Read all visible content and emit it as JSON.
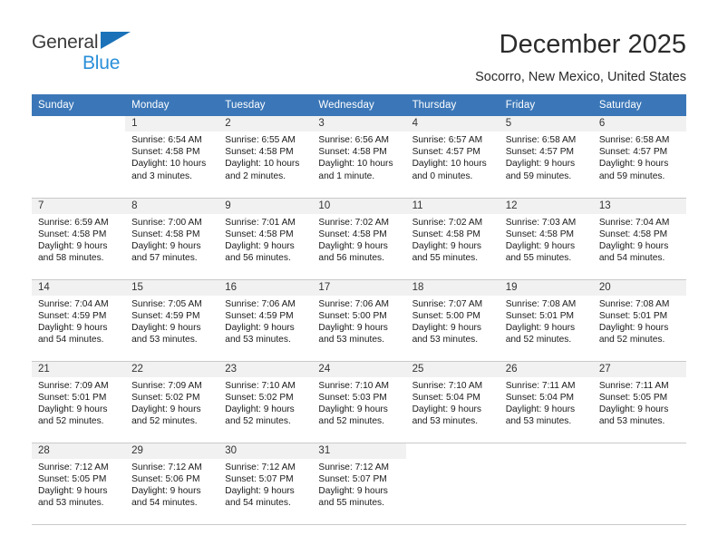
{
  "brand": {
    "line1": "General",
    "line2": "Blue",
    "triangle_color": "#1b72b8",
    "line2_color": "#2a8fd8"
  },
  "header": {
    "title": "December 2025",
    "subtitle": "Socorro, New Mexico, United States"
  },
  "theme": {
    "header_bg": "#3b77b8",
    "header_text": "#ffffff",
    "daynum_bg": "#f1f1f1",
    "grid_line": "#c9c9c9"
  },
  "weekdays": [
    "Sunday",
    "Monday",
    "Tuesday",
    "Wednesday",
    "Thursday",
    "Friday",
    "Saturday"
  ],
  "weeks": [
    [
      {
        "day": "",
        "sunrise": "",
        "sunset": "",
        "daylight_1": "",
        "daylight_2": ""
      },
      {
        "day": "1",
        "sunrise": "Sunrise: 6:54 AM",
        "sunset": "Sunset: 4:58 PM",
        "daylight_1": "Daylight: 10 hours",
        "daylight_2": "and 3 minutes."
      },
      {
        "day": "2",
        "sunrise": "Sunrise: 6:55 AM",
        "sunset": "Sunset: 4:58 PM",
        "daylight_1": "Daylight: 10 hours",
        "daylight_2": "and 2 minutes."
      },
      {
        "day": "3",
        "sunrise": "Sunrise: 6:56 AM",
        "sunset": "Sunset: 4:58 PM",
        "daylight_1": "Daylight: 10 hours",
        "daylight_2": "and 1 minute."
      },
      {
        "day": "4",
        "sunrise": "Sunrise: 6:57 AM",
        "sunset": "Sunset: 4:57 PM",
        "daylight_1": "Daylight: 10 hours",
        "daylight_2": "and 0 minutes."
      },
      {
        "day": "5",
        "sunrise": "Sunrise: 6:58 AM",
        "sunset": "Sunset: 4:57 PM",
        "daylight_1": "Daylight: 9 hours",
        "daylight_2": "and 59 minutes."
      },
      {
        "day": "6",
        "sunrise": "Sunrise: 6:58 AM",
        "sunset": "Sunset: 4:57 PM",
        "daylight_1": "Daylight: 9 hours",
        "daylight_2": "and 59 minutes."
      }
    ],
    [
      {
        "day": "7",
        "sunrise": "Sunrise: 6:59 AM",
        "sunset": "Sunset: 4:58 PM",
        "daylight_1": "Daylight: 9 hours",
        "daylight_2": "and 58 minutes."
      },
      {
        "day": "8",
        "sunrise": "Sunrise: 7:00 AM",
        "sunset": "Sunset: 4:58 PM",
        "daylight_1": "Daylight: 9 hours",
        "daylight_2": "and 57 minutes."
      },
      {
        "day": "9",
        "sunrise": "Sunrise: 7:01 AM",
        "sunset": "Sunset: 4:58 PM",
        "daylight_1": "Daylight: 9 hours",
        "daylight_2": "and 56 minutes."
      },
      {
        "day": "10",
        "sunrise": "Sunrise: 7:02 AM",
        "sunset": "Sunset: 4:58 PM",
        "daylight_1": "Daylight: 9 hours",
        "daylight_2": "and 56 minutes."
      },
      {
        "day": "11",
        "sunrise": "Sunrise: 7:02 AM",
        "sunset": "Sunset: 4:58 PM",
        "daylight_1": "Daylight: 9 hours",
        "daylight_2": "and 55 minutes."
      },
      {
        "day": "12",
        "sunrise": "Sunrise: 7:03 AM",
        "sunset": "Sunset: 4:58 PM",
        "daylight_1": "Daylight: 9 hours",
        "daylight_2": "and 55 minutes."
      },
      {
        "day": "13",
        "sunrise": "Sunrise: 7:04 AM",
        "sunset": "Sunset: 4:58 PM",
        "daylight_1": "Daylight: 9 hours",
        "daylight_2": "and 54 minutes."
      }
    ],
    [
      {
        "day": "14",
        "sunrise": "Sunrise: 7:04 AM",
        "sunset": "Sunset: 4:59 PM",
        "daylight_1": "Daylight: 9 hours",
        "daylight_2": "and 54 minutes."
      },
      {
        "day": "15",
        "sunrise": "Sunrise: 7:05 AM",
        "sunset": "Sunset: 4:59 PM",
        "daylight_1": "Daylight: 9 hours",
        "daylight_2": "and 53 minutes."
      },
      {
        "day": "16",
        "sunrise": "Sunrise: 7:06 AM",
        "sunset": "Sunset: 4:59 PM",
        "daylight_1": "Daylight: 9 hours",
        "daylight_2": "and 53 minutes."
      },
      {
        "day": "17",
        "sunrise": "Sunrise: 7:06 AM",
        "sunset": "Sunset: 5:00 PM",
        "daylight_1": "Daylight: 9 hours",
        "daylight_2": "and 53 minutes."
      },
      {
        "day": "18",
        "sunrise": "Sunrise: 7:07 AM",
        "sunset": "Sunset: 5:00 PM",
        "daylight_1": "Daylight: 9 hours",
        "daylight_2": "and 53 minutes."
      },
      {
        "day": "19",
        "sunrise": "Sunrise: 7:08 AM",
        "sunset": "Sunset: 5:01 PM",
        "daylight_1": "Daylight: 9 hours",
        "daylight_2": "and 52 minutes."
      },
      {
        "day": "20",
        "sunrise": "Sunrise: 7:08 AM",
        "sunset": "Sunset: 5:01 PM",
        "daylight_1": "Daylight: 9 hours",
        "daylight_2": "and 52 minutes."
      }
    ],
    [
      {
        "day": "21",
        "sunrise": "Sunrise: 7:09 AM",
        "sunset": "Sunset: 5:01 PM",
        "daylight_1": "Daylight: 9 hours",
        "daylight_2": "and 52 minutes."
      },
      {
        "day": "22",
        "sunrise": "Sunrise: 7:09 AM",
        "sunset": "Sunset: 5:02 PM",
        "daylight_1": "Daylight: 9 hours",
        "daylight_2": "and 52 minutes."
      },
      {
        "day": "23",
        "sunrise": "Sunrise: 7:10 AM",
        "sunset": "Sunset: 5:02 PM",
        "daylight_1": "Daylight: 9 hours",
        "daylight_2": "and 52 minutes."
      },
      {
        "day": "24",
        "sunrise": "Sunrise: 7:10 AM",
        "sunset": "Sunset: 5:03 PM",
        "daylight_1": "Daylight: 9 hours",
        "daylight_2": "and 52 minutes."
      },
      {
        "day": "25",
        "sunrise": "Sunrise: 7:10 AM",
        "sunset": "Sunset: 5:04 PM",
        "daylight_1": "Daylight: 9 hours",
        "daylight_2": "and 53 minutes."
      },
      {
        "day": "26",
        "sunrise": "Sunrise: 7:11 AM",
        "sunset": "Sunset: 5:04 PM",
        "daylight_1": "Daylight: 9 hours",
        "daylight_2": "and 53 minutes."
      },
      {
        "day": "27",
        "sunrise": "Sunrise: 7:11 AM",
        "sunset": "Sunset: 5:05 PM",
        "daylight_1": "Daylight: 9 hours",
        "daylight_2": "and 53 minutes."
      }
    ],
    [
      {
        "day": "28",
        "sunrise": "Sunrise: 7:12 AM",
        "sunset": "Sunset: 5:05 PM",
        "daylight_1": "Daylight: 9 hours",
        "daylight_2": "and 53 minutes."
      },
      {
        "day": "29",
        "sunrise": "Sunrise: 7:12 AM",
        "sunset": "Sunset: 5:06 PM",
        "daylight_1": "Daylight: 9 hours",
        "daylight_2": "and 54 minutes."
      },
      {
        "day": "30",
        "sunrise": "Sunrise: 7:12 AM",
        "sunset": "Sunset: 5:07 PM",
        "daylight_1": "Daylight: 9 hours",
        "daylight_2": "and 54 minutes."
      },
      {
        "day": "31",
        "sunrise": "Sunrise: 7:12 AM",
        "sunset": "Sunset: 5:07 PM",
        "daylight_1": "Daylight: 9 hours",
        "daylight_2": "and 55 minutes."
      },
      {
        "day": "",
        "sunrise": "",
        "sunset": "",
        "daylight_1": "",
        "daylight_2": ""
      },
      {
        "day": "",
        "sunrise": "",
        "sunset": "",
        "daylight_1": "",
        "daylight_2": ""
      },
      {
        "day": "",
        "sunrise": "",
        "sunset": "",
        "daylight_1": "",
        "daylight_2": ""
      }
    ]
  ]
}
